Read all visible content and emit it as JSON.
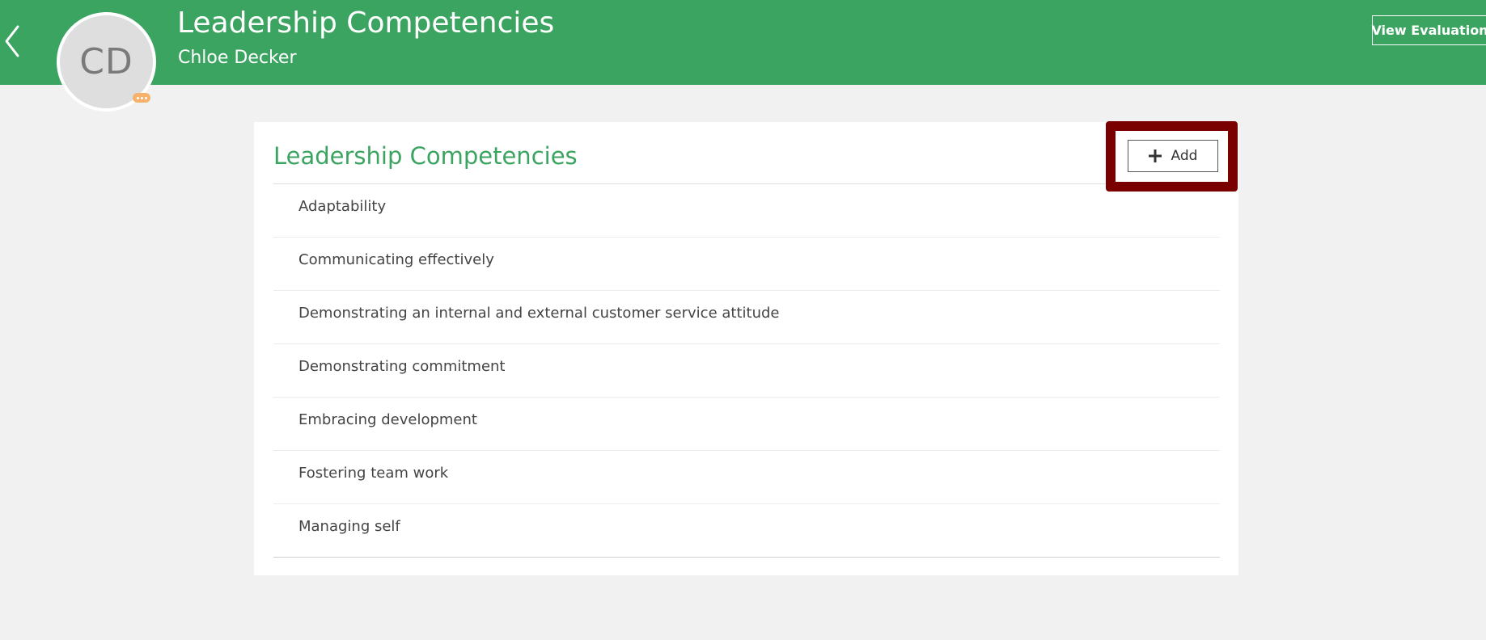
{
  "header": {
    "title": "Leadership Competencies",
    "subtitle": "Chloe Decker",
    "view_evaluation_label": "View Evaluation",
    "back_icon": "chevron-left-icon",
    "background_color": "#3ca461"
  },
  "avatar": {
    "initials": "CD",
    "presence_icon": "more-dots-icon",
    "presence_color": "#f6b26b"
  },
  "card": {
    "title": "Leadership Competencies",
    "add_label": "Add",
    "add_icon": "plus-icon",
    "items": [
      {
        "label": "Adaptability"
      },
      {
        "label": "Communicating effectively"
      },
      {
        "label": "Demonstrating an internal and external customer service attitude"
      },
      {
        "label": "Demonstrating commitment"
      },
      {
        "label": "Embracing development"
      },
      {
        "label": "Fostering team work"
      },
      {
        "label": "Managing self"
      }
    ]
  },
  "highlight_color": "#7a0000"
}
